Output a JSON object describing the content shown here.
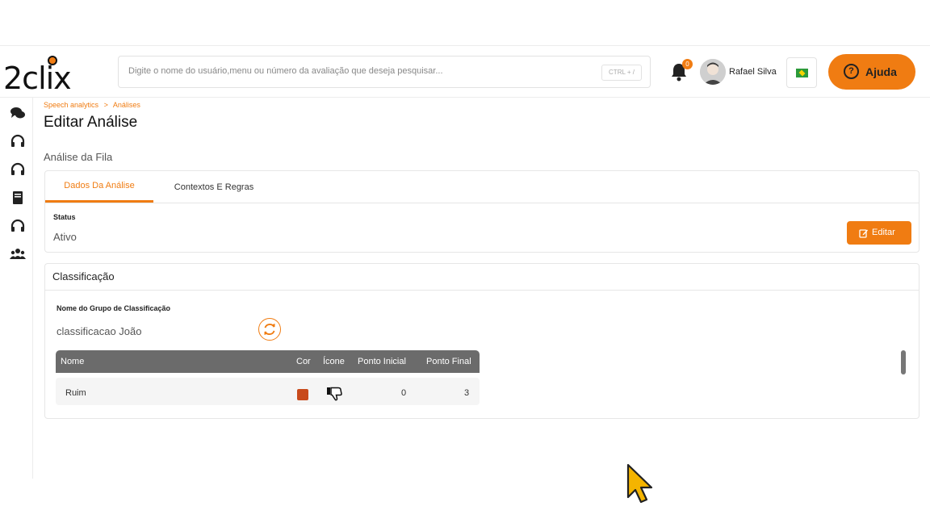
{
  "brand": {
    "name": "2clix",
    "accent": "#f07c12"
  },
  "header": {
    "search_placeholder": "Digite o nome do usuário,menu ou número da avaliação que deseja pesquisar...",
    "search_shortcut": "CTRL + /",
    "notification_count": "0",
    "user_name": "Rafael Silva",
    "help_label": "Ajuda",
    "help_glyph": "?"
  },
  "sidebar": {
    "items": [
      {
        "icon": "chat-bubbles-icon"
      },
      {
        "icon": "headset-icon"
      },
      {
        "icon": "headset-icon"
      },
      {
        "icon": "book-icon"
      },
      {
        "icon": "headset-icon"
      },
      {
        "icon": "users-icon"
      }
    ]
  },
  "breadcrumb": {
    "parent": "Speech analytics",
    "separator": ">",
    "current": "Análises"
  },
  "page": {
    "title": "Editar Análise",
    "section": "Análise da Fila"
  },
  "tabs": [
    {
      "label": "Dados Da Análise",
      "active": true
    },
    {
      "label": "Contextos E Regras",
      "active": false
    }
  ],
  "status": {
    "label": "Status",
    "value": "Ativo",
    "edit_label": "Editar"
  },
  "classification": {
    "title": "Classificação",
    "group_label": "Nome do Grupo de Classificação",
    "group_value": "classificacao João",
    "columns": [
      "Nome",
      "Cor",
      "Ícone",
      "Ponto Inicial",
      "Ponto Final"
    ],
    "rows": [
      {
        "name": "Ruim",
        "color": "#c84a1b",
        "icon": "thumbs-down-icon",
        "start": "0",
        "end": "3"
      }
    ]
  }
}
